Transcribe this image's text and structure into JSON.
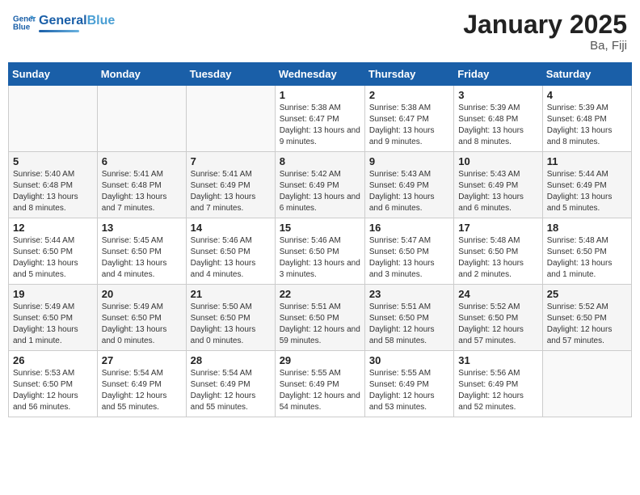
{
  "header": {
    "logo_general": "General",
    "logo_blue": "Blue",
    "month_title": "January 2025",
    "location": "Ba, Fiji"
  },
  "days_of_week": [
    "Sunday",
    "Monday",
    "Tuesday",
    "Wednesday",
    "Thursday",
    "Friday",
    "Saturday"
  ],
  "weeks": [
    {
      "days": [
        {
          "number": "",
          "info": ""
        },
        {
          "number": "",
          "info": ""
        },
        {
          "number": "",
          "info": ""
        },
        {
          "number": "1",
          "info": "Sunrise: 5:38 AM\nSunset: 6:47 PM\nDaylight: 13 hours and 9 minutes."
        },
        {
          "number": "2",
          "info": "Sunrise: 5:38 AM\nSunset: 6:47 PM\nDaylight: 13 hours and 9 minutes."
        },
        {
          "number": "3",
          "info": "Sunrise: 5:39 AM\nSunset: 6:48 PM\nDaylight: 13 hours and 8 minutes."
        },
        {
          "number": "4",
          "info": "Sunrise: 5:39 AM\nSunset: 6:48 PM\nDaylight: 13 hours and 8 minutes."
        }
      ]
    },
    {
      "days": [
        {
          "number": "5",
          "info": "Sunrise: 5:40 AM\nSunset: 6:48 PM\nDaylight: 13 hours and 8 minutes."
        },
        {
          "number": "6",
          "info": "Sunrise: 5:41 AM\nSunset: 6:48 PM\nDaylight: 13 hours and 7 minutes."
        },
        {
          "number": "7",
          "info": "Sunrise: 5:41 AM\nSunset: 6:49 PM\nDaylight: 13 hours and 7 minutes."
        },
        {
          "number": "8",
          "info": "Sunrise: 5:42 AM\nSunset: 6:49 PM\nDaylight: 13 hours and 6 minutes."
        },
        {
          "number": "9",
          "info": "Sunrise: 5:43 AM\nSunset: 6:49 PM\nDaylight: 13 hours and 6 minutes."
        },
        {
          "number": "10",
          "info": "Sunrise: 5:43 AM\nSunset: 6:49 PM\nDaylight: 13 hours and 6 minutes."
        },
        {
          "number": "11",
          "info": "Sunrise: 5:44 AM\nSunset: 6:49 PM\nDaylight: 13 hours and 5 minutes."
        }
      ]
    },
    {
      "days": [
        {
          "number": "12",
          "info": "Sunrise: 5:44 AM\nSunset: 6:50 PM\nDaylight: 13 hours and 5 minutes."
        },
        {
          "number": "13",
          "info": "Sunrise: 5:45 AM\nSunset: 6:50 PM\nDaylight: 13 hours and 4 minutes."
        },
        {
          "number": "14",
          "info": "Sunrise: 5:46 AM\nSunset: 6:50 PM\nDaylight: 13 hours and 4 minutes."
        },
        {
          "number": "15",
          "info": "Sunrise: 5:46 AM\nSunset: 6:50 PM\nDaylight: 13 hours and 3 minutes."
        },
        {
          "number": "16",
          "info": "Sunrise: 5:47 AM\nSunset: 6:50 PM\nDaylight: 13 hours and 3 minutes."
        },
        {
          "number": "17",
          "info": "Sunrise: 5:48 AM\nSunset: 6:50 PM\nDaylight: 13 hours and 2 minutes."
        },
        {
          "number": "18",
          "info": "Sunrise: 5:48 AM\nSunset: 6:50 PM\nDaylight: 13 hours and 1 minute."
        }
      ]
    },
    {
      "days": [
        {
          "number": "19",
          "info": "Sunrise: 5:49 AM\nSunset: 6:50 PM\nDaylight: 13 hours and 1 minute."
        },
        {
          "number": "20",
          "info": "Sunrise: 5:49 AM\nSunset: 6:50 PM\nDaylight: 13 hours and 0 minutes."
        },
        {
          "number": "21",
          "info": "Sunrise: 5:50 AM\nSunset: 6:50 PM\nDaylight: 13 hours and 0 minutes."
        },
        {
          "number": "22",
          "info": "Sunrise: 5:51 AM\nSunset: 6:50 PM\nDaylight: 12 hours and 59 minutes."
        },
        {
          "number": "23",
          "info": "Sunrise: 5:51 AM\nSunset: 6:50 PM\nDaylight: 12 hours and 58 minutes."
        },
        {
          "number": "24",
          "info": "Sunrise: 5:52 AM\nSunset: 6:50 PM\nDaylight: 12 hours and 57 minutes."
        },
        {
          "number": "25",
          "info": "Sunrise: 5:52 AM\nSunset: 6:50 PM\nDaylight: 12 hours and 57 minutes."
        }
      ]
    },
    {
      "days": [
        {
          "number": "26",
          "info": "Sunrise: 5:53 AM\nSunset: 6:50 PM\nDaylight: 12 hours and 56 minutes."
        },
        {
          "number": "27",
          "info": "Sunrise: 5:54 AM\nSunset: 6:49 PM\nDaylight: 12 hours and 55 minutes."
        },
        {
          "number": "28",
          "info": "Sunrise: 5:54 AM\nSunset: 6:49 PM\nDaylight: 12 hours and 55 minutes."
        },
        {
          "number": "29",
          "info": "Sunrise: 5:55 AM\nSunset: 6:49 PM\nDaylight: 12 hours and 54 minutes."
        },
        {
          "number": "30",
          "info": "Sunrise: 5:55 AM\nSunset: 6:49 PM\nDaylight: 12 hours and 53 minutes."
        },
        {
          "number": "31",
          "info": "Sunrise: 5:56 AM\nSunset: 6:49 PM\nDaylight: 12 hours and 52 minutes."
        },
        {
          "number": "",
          "info": ""
        }
      ]
    }
  ]
}
